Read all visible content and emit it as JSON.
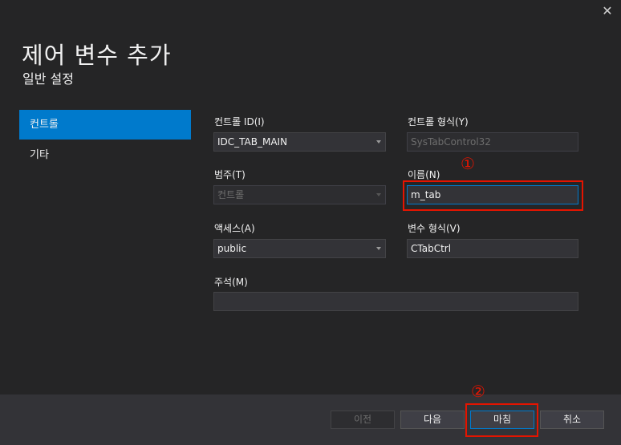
{
  "dialog": {
    "close_glyph": "✕",
    "title": "제어 변수 추가",
    "subtitle": "일반 설정"
  },
  "nav": {
    "items": [
      {
        "label": "컨트롤",
        "active": true
      },
      {
        "label": "기타",
        "active": false
      }
    ]
  },
  "form": {
    "control_id": {
      "label": "컨트롤 ID(I)",
      "value": "IDC_TAB_MAIN"
    },
    "control_type": {
      "label": "컨트롤 형식(Y)",
      "value": "SysTabControl32"
    },
    "category": {
      "label": "범주(T)",
      "value": "컨트롤"
    },
    "name": {
      "label": "이름(N)",
      "value": "m_tab"
    },
    "access": {
      "label": "액세스(A)",
      "value": "public"
    },
    "variable_type": {
      "label": "변수 형식(V)",
      "value": "CTabCtrl"
    },
    "comment": {
      "label": "주석(M)",
      "value": ""
    }
  },
  "annotations": {
    "marker1": "①",
    "marker2": "②",
    "color": "#e51400"
  },
  "buttons": {
    "prev": "이전",
    "next": "다음",
    "finish": "마침",
    "cancel": "취소"
  },
  "colors": {
    "accent": "#007acc",
    "background": "#252526"
  }
}
